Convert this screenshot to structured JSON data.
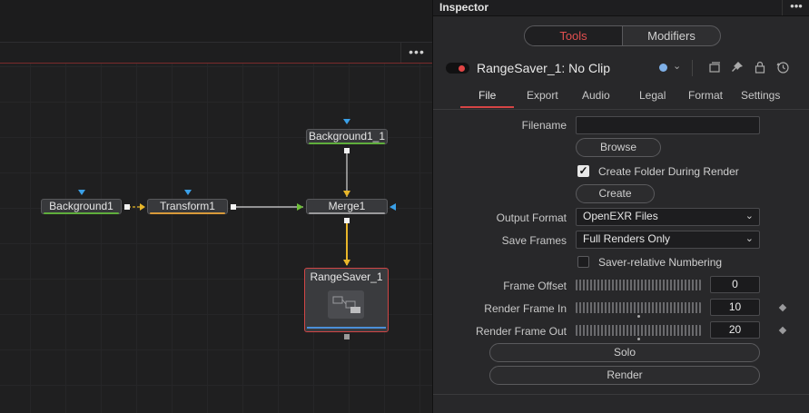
{
  "node_editor": {
    "menu_label": "•••",
    "nodes": {
      "background1": "Background1",
      "transform1": "Transform1",
      "background1_1": "Background1_1",
      "merge1": "Merge1",
      "rangesaver": "RangeSaver_1"
    }
  },
  "inspector": {
    "title": "Inspector",
    "menu_label": "•••",
    "segment": {
      "tools": "Tools",
      "modifiers": "Modifiers"
    },
    "tool_name": "RangeSaver_1: No Clip",
    "tabs": [
      "File",
      "Export",
      "Audio",
      "Legal",
      "Format",
      "Settings"
    ],
    "file": {
      "filename_label": "Filename",
      "filename_value": "",
      "browse": "Browse",
      "create_folder_label": "Create Folder During Render",
      "create_folder_checked": true,
      "create": "Create",
      "output_format_label": "Output Format",
      "output_format_value": "OpenEXR Files",
      "save_frames_label": "Save Frames",
      "save_frames_value": "Full Renders Only",
      "saver_relative_label": "Saver-relative Numbering",
      "saver_relative_checked": false,
      "frame_offset_label": "Frame Offset",
      "frame_offset_value": "0",
      "render_in_label": "Render Frame In",
      "render_in_value": "10",
      "render_out_label": "Render Frame Out",
      "render_out_value": "20",
      "solo": "Solo",
      "render": "Render",
      "check_glyph": "✓",
      "dropdown_arrow": "⌄"
    }
  },
  "colors": {
    "accent_red": "#e14f4f",
    "wire_yellow": "#e8b62a",
    "input_blue": "#3aa0e8",
    "node_green": "#5fae3c",
    "node_orange": "#d89a3a"
  }
}
